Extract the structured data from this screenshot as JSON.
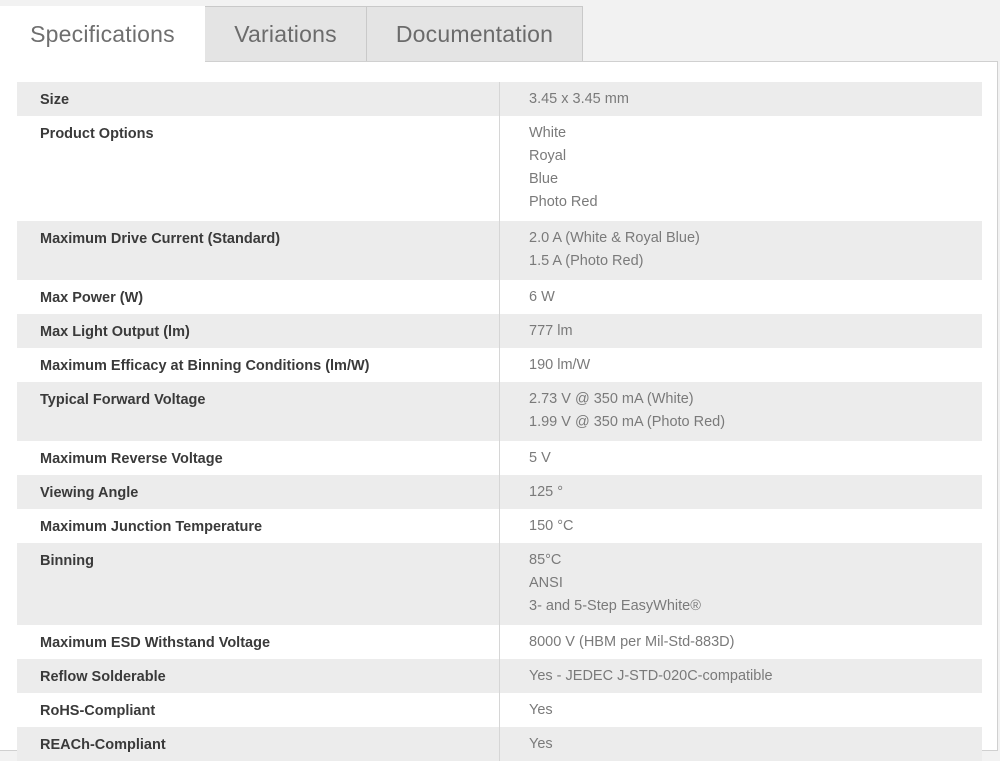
{
  "tabs": [
    {
      "label": "Specifications",
      "active": true
    },
    {
      "label": "Variations",
      "active": false
    },
    {
      "label": "Documentation",
      "active": false
    }
  ],
  "specs": [
    {
      "label": "Size",
      "values": [
        "3.45 x 3.45 mm"
      ]
    },
    {
      "label": "Product Options",
      "values": [
        "White",
        "Royal",
        "Blue",
        "Photo Red"
      ]
    },
    {
      "label": "Maximum Drive Current (Standard)",
      "values": [
        "2.0 A (White & Royal Blue)",
        "1.5 A (Photo Red)"
      ]
    },
    {
      "label": "Max Power (W)",
      "values": [
        "6 W"
      ]
    },
    {
      "label": "Max Light Output (lm)",
      "values": [
        "777 lm"
      ]
    },
    {
      "label": "Maximum Efficacy at Binning Conditions (lm/W)",
      "values": [
        "190 lm/W"
      ]
    },
    {
      "label": "Typical Forward Voltage",
      "values": [
        "2.73 V @ 350 mA (White)",
        "1.99 V @ 350 mA (Photo Red)"
      ]
    },
    {
      "label": "Maximum Reverse Voltage",
      "values": [
        "5 V"
      ]
    },
    {
      "label": "Viewing Angle",
      "values": [
        "125 °"
      ]
    },
    {
      "label": "Maximum Junction Temperature",
      "values": [
        "150 °C"
      ]
    },
    {
      "label": "Binning",
      "values": [
        "85°C",
        "ANSI",
        "3- and 5-Step EasyWhite®"
      ]
    },
    {
      "label": "Maximum ESD Withstand Voltage",
      "values": [
        "8000 V (HBM per Mil-Std-883D)"
      ]
    },
    {
      "label": "Reflow Solderable",
      "values": [
        "Yes - JEDEC J-STD-020C-compatible"
      ]
    },
    {
      "label": "RoHS-Compliant",
      "values": [
        "Yes"
      ]
    },
    {
      "label": "REACh-Compliant",
      "values": [
        "Yes"
      ]
    }
  ]
}
